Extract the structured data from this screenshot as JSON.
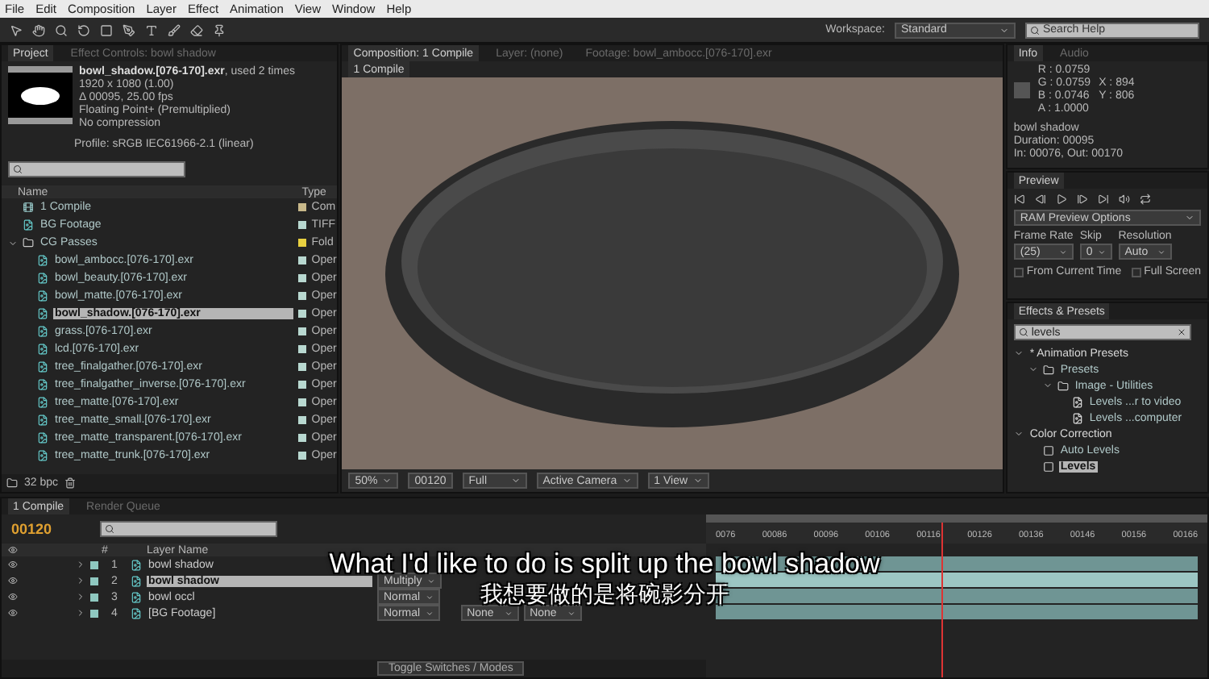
{
  "menu": [
    "File",
    "Edit",
    "Composition",
    "Layer",
    "Effect",
    "Animation",
    "View",
    "Window",
    "Help"
  ],
  "workspace": {
    "label": "Workspace:",
    "value": "Standard"
  },
  "search_help": {
    "placeholder": "Search Help"
  },
  "project": {
    "tabs": [
      {
        "label": "Project",
        "selected": true
      },
      {
        "label": "Effect Controls: bowl shadow",
        "selected": false
      }
    ],
    "file": {
      "name": "bowl_shadow.[076-170].exr",
      "note": ", used 2 times",
      "lines": [
        "1920 x 1080 (1.00)",
        "Δ 00095, 25.00 fps",
        "Floating Point+ (Premultiplied)",
        "No compression"
      ],
      "profile": "Profile: sRGB IEC61966-2.1 (linear)"
    },
    "columns": [
      "Name",
      "Type"
    ],
    "items": [
      {
        "name": "1 Compile",
        "type": "Com",
        "kind": "comp",
        "color": "#c8b88a",
        "selected": false
      },
      {
        "name": "BG Footage",
        "type": "TIFF",
        "kind": "footage",
        "color": "#b8d8d0",
        "selected": false
      },
      {
        "name": "CG Passes",
        "type": "Fold",
        "kind": "folder",
        "color": "#e8d040",
        "selected": false,
        "expanded": true,
        "children": [
          {
            "name": "bowl_ambocc.[076-170].exr",
            "type": "Oper",
            "kind": "footage",
            "color": "#b8d8d0",
            "selected": false
          },
          {
            "name": "bowl_beauty.[076-170].exr",
            "type": "Oper",
            "kind": "footage",
            "color": "#b8d8d0",
            "selected": false
          },
          {
            "name": "bowl_matte.[076-170].exr",
            "type": "Oper",
            "kind": "footage",
            "color": "#b8d8d0",
            "selected": false
          },
          {
            "name": "bowl_shadow.[076-170].exr",
            "type": "Oper",
            "kind": "footage",
            "color": "#b8d8d0",
            "selected": true
          },
          {
            "name": "grass.[076-170].exr",
            "type": "Oper",
            "kind": "footage",
            "color": "#b8d8d0",
            "selected": false
          },
          {
            "name": "lcd.[076-170].exr",
            "type": "Oper",
            "kind": "footage",
            "color": "#b8d8d0",
            "selected": false
          },
          {
            "name": "tree_finalgather.[076-170].exr",
            "type": "Oper",
            "kind": "footage",
            "color": "#b8d8d0",
            "selected": false
          },
          {
            "name": "tree_finalgather_inverse.[076-170].exr",
            "type": "Oper",
            "kind": "footage",
            "color": "#b8d8d0",
            "selected": false
          },
          {
            "name": "tree_matte.[076-170].exr",
            "type": "Oper",
            "kind": "footage",
            "color": "#b8d8d0",
            "selected": false
          },
          {
            "name": "tree_matte_small.[076-170].exr",
            "type": "Oper",
            "kind": "footage",
            "color": "#b8d8d0",
            "selected": false
          },
          {
            "name": "tree_matte_transparent.[076-170].exr",
            "type": "Oper",
            "kind": "footage",
            "color": "#b8d8d0",
            "selected": false
          },
          {
            "name": "tree_matte_trunk.[076-170].exr",
            "type": "Oper",
            "kind": "footage",
            "color": "#b8d8d0",
            "selected": false
          }
        ]
      }
    ],
    "bpc": "32 bpc"
  },
  "comp": {
    "tabs": [
      {
        "label": "Composition: 1 Compile",
        "selected": true
      },
      {
        "label": "Layer: (none)",
        "selected": false
      },
      {
        "label": "Footage: bowl_ambocc.[076-170].exr",
        "selected": false
      }
    ],
    "breadcrumb": "1 Compile",
    "zoom": "50%",
    "timecode": "00120",
    "resolution": "Full",
    "camera": "Active Camera",
    "views": "1 View"
  },
  "info": {
    "tabs": [
      {
        "label": "Info",
        "selected": true
      },
      {
        "label": "Audio",
        "selected": false
      }
    ],
    "channels": [
      "R : 0.0759",
      "G : 0.0759",
      "B : 0.0746",
      "A : 1.0000"
    ],
    "coords": [
      "X : 894",
      "Y : 806"
    ],
    "details": [
      "bowl shadow",
      "Duration: 00095",
      "In: 00076, Out: 00170"
    ]
  },
  "preview": {
    "tab": "Preview",
    "ram": "RAM Preview Options",
    "fields": [
      {
        "label": "Frame Rate",
        "value": "(25)"
      },
      {
        "label": "Skip",
        "value": "0"
      },
      {
        "label": "Resolution",
        "value": "Auto"
      }
    ],
    "options": [
      {
        "label": "From Current Time",
        "checked": false
      },
      {
        "label": "Full Screen",
        "checked": false
      }
    ]
  },
  "effects": {
    "tab": "Effects & Presets",
    "search": "levels",
    "items": [
      {
        "name": "* Animation Presets",
        "kind": "section",
        "selected": false,
        "expanded": true,
        "children": [
          {
            "name": "Presets",
            "kind": "folder",
            "selected": false,
            "expanded": true,
            "children": [
              {
                "name": "Image - Utilities",
                "kind": "folder",
                "selected": false,
                "expanded": true,
                "children": [
                  {
                    "name": "Levels ...r to video",
                    "kind": "preset",
                    "selected": false
                  },
                  {
                    "name": "Levels ...computer",
                    "kind": "preset",
                    "selected": false
                  }
                ]
              }
            ]
          }
        ]
      },
      {
        "name": "Color Correction",
        "kind": "section",
        "selected": false,
        "expanded": true,
        "children": [
          {
            "name": "Auto Levels",
            "kind": "effect",
            "selected": false
          },
          {
            "name": "Levels",
            "kind": "effect",
            "selected": true
          }
        ]
      }
    ]
  },
  "timeline": {
    "tabs": [
      {
        "label": "1 Compile",
        "selected": true
      },
      {
        "label": "Render Queue",
        "selected": false
      }
    ],
    "timecode": "00120",
    "columns": [
      "#",
      "Layer Name"
    ],
    "layers": [
      {
        "number": "1",
        "name": "bowl shadow",
        "selected": false,
        "color": "#8fc8c0"
      },
      {
        "number": "2",
        "name": "bowl shadow",
        "mode": "Multiply",
        "selected": true,
        "color": "#8fc8c0"
      },
      {
        "number": "3",
        "name": "bowl occl",
        "mode": "Normal",
        "selected": false,
        "color": "#8fc8c0"
      },
      {
        "number": "4",
        "name": "[BG Footage]",
        "mode": "Normal",
        "track_matte": "None",
        "parent": "None",
        "selected": false,
        "color": "#8fc8c0"
      }
    ],
    "ticks": [
      "0076",
      "00086",
      "00096",
      "00106",
      "00116",
      "00126",
      "00136",
      "00146",
      "00156",
      "00166"
    ],
    "toggle": "Toggle Switches / Modes"
  },
  "subtitles": [
    "What I'd like to do is split up the bowl shadow",
    "我想要做的是将碗影分开"
  ]
}
